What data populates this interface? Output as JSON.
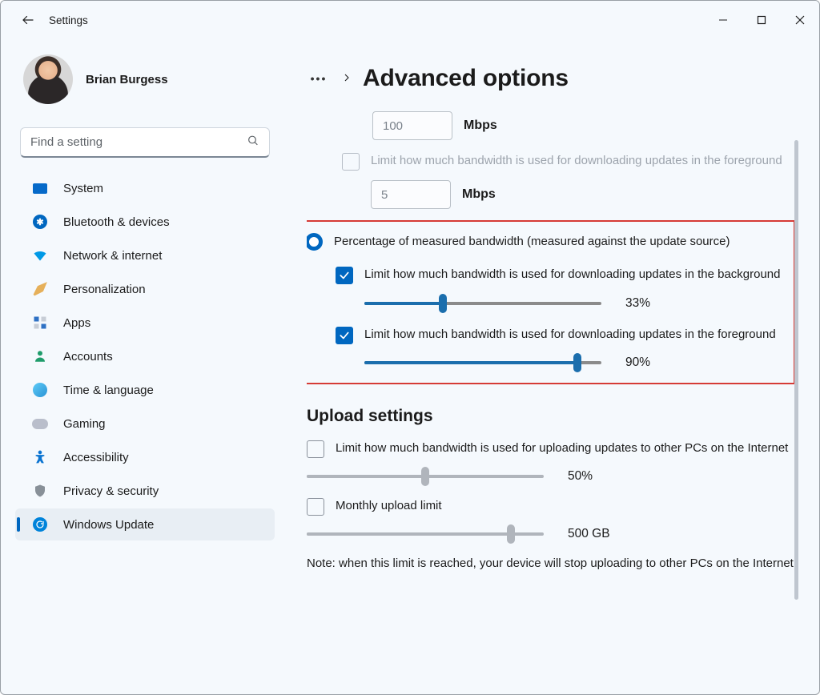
{
  "app": {
    "title": "Settings"
  },
  "profile": {
    "name": "Brian Burgess"
  },
  "search": {
    "placeholder": "Find a setting"
  },
  "nav": {
    "items": [
      {
        "label": "System"
      },
      {
        "label": "Bluetooth & devices"
      },
      {
        "label": "Network & internet"
      },
      {
        "label": "Personalization"
      },
      {
        "label": "Apps"
      },
      {
        "label": "Accounts"
      },
      {
        "label": "Time & language"
      },
      {
        "label": "Gaming"
      },
      {
        "label": "Accessibility"
      },
      {
        "label": "Privacy & security"
      },
      {
        "label": "Windows Update"
      }
    ],
    "active_index": 10
  },
  "page": {
    "title": "Advanced options",
    "bg_abs_value": "100",
    "fg_abs_value": "5",
    "unit": "Mbps",
    "fg_limit_disabled_label": "Limit how much bandwidth is used for downloading updates in the foreground",
    "radio_label": "Percentage of measured bandwidth (measured against the update source)",
    "bg_pct_label": "Limit how much bandwidth is used for downloading updates in the background",
    "bg_pct_value": 33,
    "bg_pct_text": "33%",
    "fg_pct_label": "Limit how much bandwidth is used for downloading updates in the foreground",
    "fg_pct_value": 90,
    "fg_pct_text": "90%",
    "upload_heading": "Upload settings",
    "up_bw_label": "Limit how much bandwidth is used for uploading updates to other PCs on the Internet",
    "up_bw_value": 50,
    "up_bw_text": "50%",
    "up_monthly_label": "Monthly upload limit",
    "up_monthly_value": 86,
    "up_monthly_text": "500 GB",
    "note": "Note: when this limit is reached, your device will stop uploading to other PCs on the Internet."
  }
}
